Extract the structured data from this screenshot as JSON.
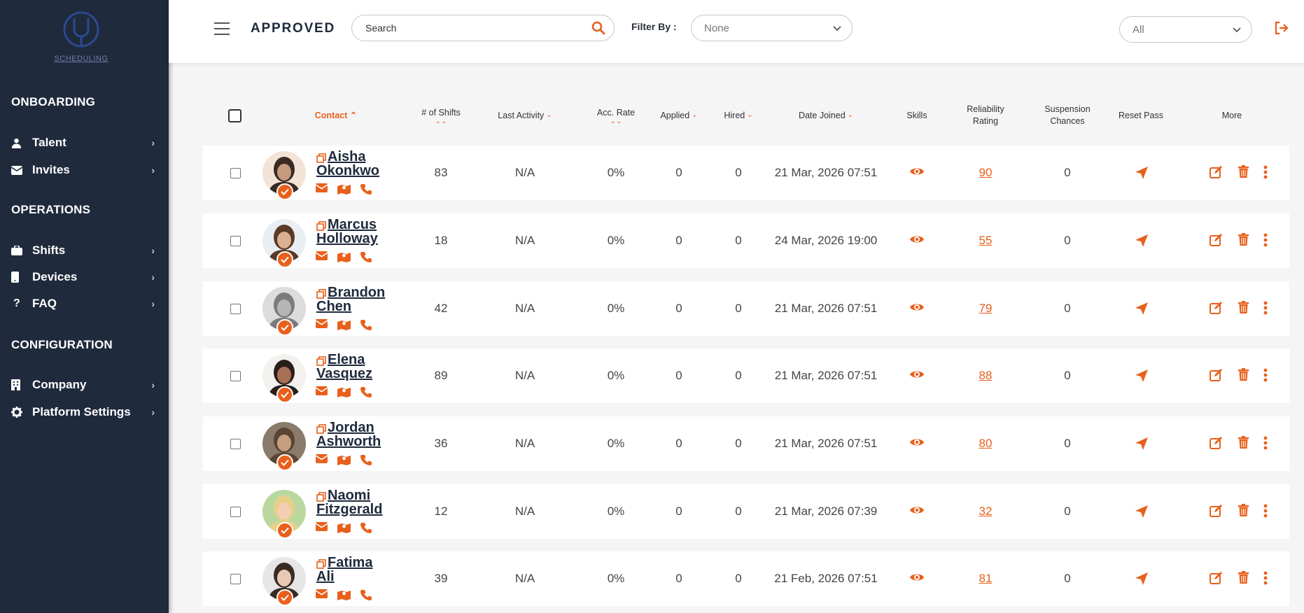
{
  "colors": {
    "accent": "#e8601c",
    "sidebar_bg": "#1f2a3c"
  },
  "sidebar": {
    "logo_text": "SCHEDULING",
    "sections": [
      "ONBOARDING",
      "OPERATIONS",
      "CONFIGURATION"
    ],
    "items": [
      {
        "label": "Talent",
        "icon": "user-icon"
      },
      {
        "label": "Invites",
        "icon": "envelope-icon"
      },
      {
        "label": "Shifts",
        "icon": "briefcase-icon"
      },
      {
        "label": "Devices",
        "icon": "phone-icon"
      },
      {
        "label": "FAQ",
        "icon": "question-icon"
      },
      {
        "label": "Company",
        "icon": "building-icon"
      },
      {
        "label": "Platform Settings",
        "icon": "gear-icon"
      }
    ]
  },
  "header": {
    "title": "APPROVED",
    "search_placeholder": "Search",
    "filter_label": "Filter By :",
    "filter_value": "None",
    "scope_value": "All"
  },
  "table": {
    "columns": {
      "contact": "Contact",
      "shifts": "# of Shifts",
      "last_activity": "Last Activity",
      "acc_rate": "Acc. Rate",
      "applied": "Applied",
      "hired": "Hired",
      "date_joined": "Date Joined",
      "skills": "Skills",
      "reliability": "Reliability Rating",
      "suspension": "Suspension Chances",
      "reset_pass": "Reset Pass",
      "more": "More"
    },
    "rows": [
      {
        "first": "Aisha",
        "last": "Okonkwo",
        "shifts": "83",
        "last_activity": "N/A",
        "acc_rate": "0%",
        "applied": "0",
        "hired": "0",
        "date_joined": "21 Mar, 2026 07:51",
        "reliability": "90",
        "suspension": "0"
      },
      {
        "first": "Marcus",
        "last": "Holloway",
        "shifts": "18",
        "last_activity": "N/A",
        "acc_rate": "0%",
        "applied": "0",
        "hired": "0",
        "date_joined": "24 Mar, 2026 19:00",
        "reliability": "55",
        "suspension": "0"
      },
      {
        "first": "Brandon",
        "last": "Chen",
        "shifts": "42",
        "last_activity": "N/A",
        "acc_rate": "0%",
        "applied": "0",
        "hired": "0",
        "date_joined": "21 Mar, 2026 07:51",
        "reliability": "79",
        "suspension": "0"
      },
      {
        "first": "Elena",
        "last": "Vasquez",
        "shifts": "89",
        "last_activity": "N/A",
        "acc_rate": "0%",
        "applied": "0",
        "hired": "0",
        "date_joined": "21 Mar, 2026 07:51",
        "reliability": "88",
        "suspension": "0"
      },
      {
        "first": "Jordan",
        "last": "Ashworth",
        "shifts": "36",
        "last_activity": "N/A",
        "acc_rate": "0%",
        "applied": "0",
        "hired": "0",
        "date_joined": "21 Mar, 2026 07:51",
        "reliability": "80",
        "suspension": "0"
      },
      {
        "first": "Naomi",
        "last": "Fitzgerald",
        "shifts": "12",
        "last_activity": "N/A",
        "acc_rate": "0%",
        "applied": "0",
        "hired": "0",
        "date_joined": "21 Mar, 2026 07:39",
        "reliability": "32",
        "suspension": "0"
      },
      {
        "first": "Fatima",
        "last": "Ali",
        "shifts": "39",
        "last_activity": "N/A",
        "acc_rate": "0%",
        "applied": "0",
        "hired": "0",
        "date_joined": "21 Feb, 2026 07:51",
        "reliability": "81",
        "suspension": "0"
      }
    ]
  }
}
